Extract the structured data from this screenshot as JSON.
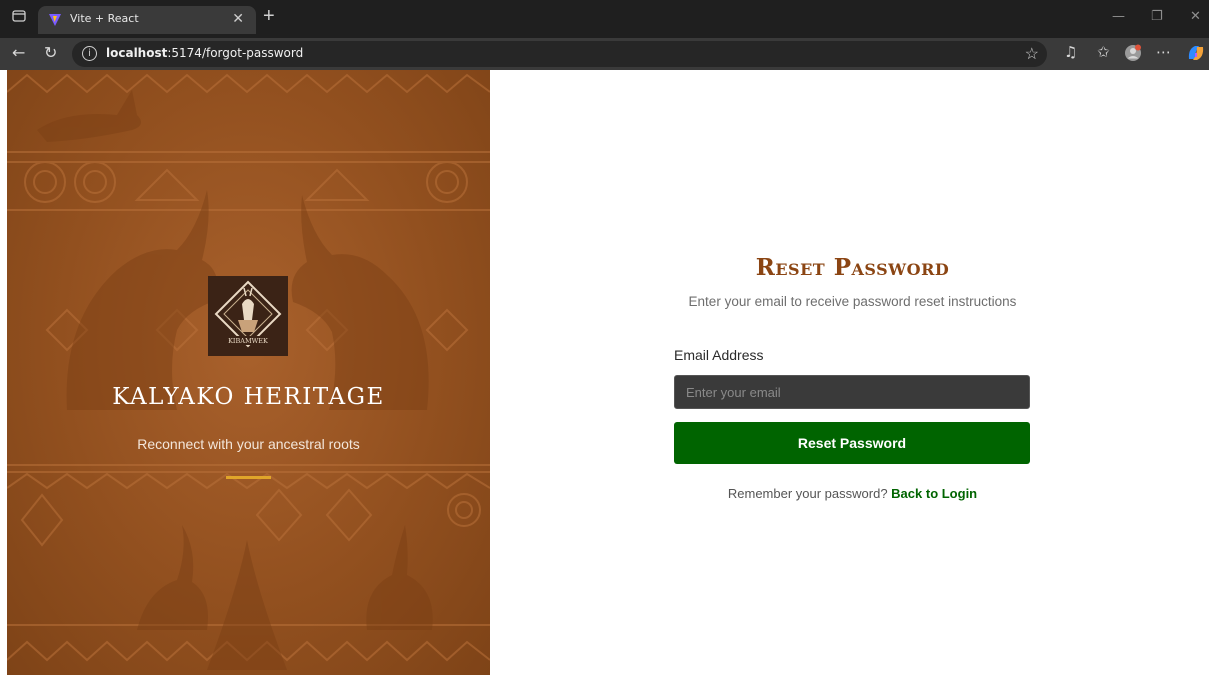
{
  "browser": {
    "tab_title": "Vite + React",
    "url_host": "localhost",
    "url_rest": ":5174/forgot-password",
    "icons": [
      "sidebar-toggle-icon",
      "vite-favicon-icon",
      "close-icon",
      "new-tab-icon",
      "back-icon",
      "refresh-icon",
      "info-icon",
      "favorite-star-icon",
      "read-aloud-icon",
      "favorites-icon",
      "profile-icon",
      "more-icon",
      "copilot-icon"
    ]
  },
  "hero": {
    "logo_text": "KIBAMWEK",
    "title": "KALYAKO HERITAGE",
    "subtitle": "Reconnect with your ancestral roots",
    "accent_color": "#e0a52a"
  },
  "form": {
    "title": "Reset Password",
    "description": "Enter your email to receive password reset instructions",
    "email_label": "Email Address",
    "email_placeholder": "Enter your email",
    "email_value": "",
    "submit_label": "Reset Password",
    "remember_text": "Remember your password?",
    "back_link": "Back to Login",
    "brand_color": "#8b4513",
    "button_color": "#006400"
  }
}
